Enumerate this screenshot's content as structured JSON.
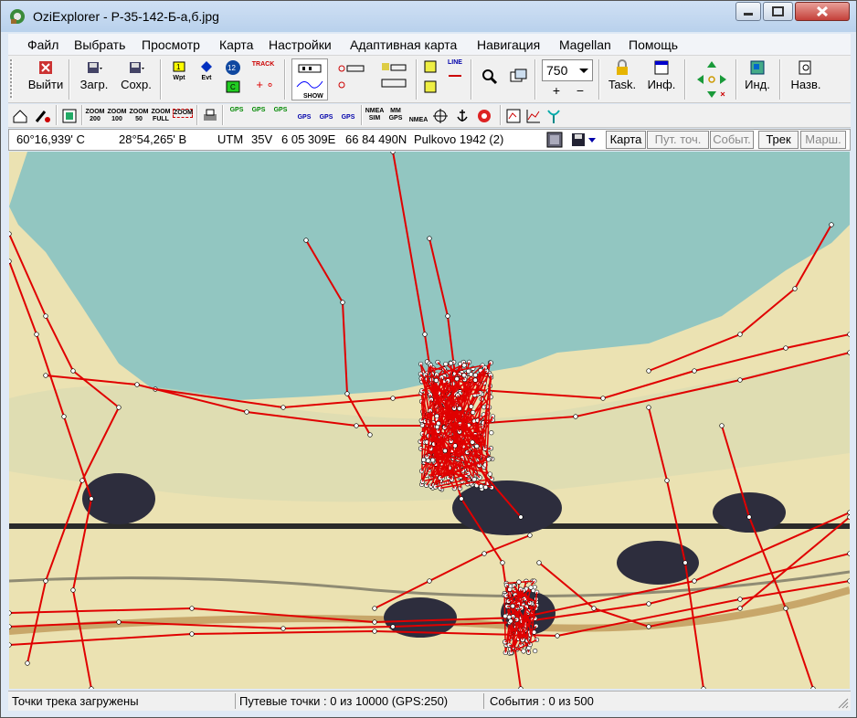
{
  "window": {
    "title": "OziExplorer - P-35-142-Б-а,б.jpg"
  },
  "menu": [
    "Файл",
    "Выбрать",
    "Просмотр",
    "Карта",
    "Настройки",
    "Адаптивная карта",
    "Навигация",
    "Magellan",
    "Помощь"
  ],
  "toolbar": {
    "exit": "Выйти",
    "load": "Загр.",
    "save": "Сохр.",
    "wpt": "Wpt",
    "evt": "Evt",
    "track": "TRACK",
    "show": "SHOW",
    "zoom_value": "750",
    "task": "Task.",
    "info": "Инф.",
    "ind": "Инд.",
    "name": "Назв.",
    "line": "LINE"
  },
  "toolbar2": {
    "zoom": [
      "ZOOM 200",
      "ZOOM 100",
      "ZOOM 50",
      "ZOOM FULL",
      "ZOOM"
    ],
    "gps": [
      "GPS",
      "GPS",
      "GPS",
      "GPS",
      "GPS",
      "GPS"
    ],
    "nmea_sim": "NMEA SIM",
    "mm_gps": "MM GPS",
    "nmea": "NMEA"
  },
  "position": {
    "lat": "60°16,939' С",
    "lon": "28°54,265' В",
    "utm_label": "UTM",
    "utm_zone": "35V",
    "easting": "6 05 309E",
    "northing": "66 84 490N",
    "datum": "Pulkovo 1942 (2)"
  },
  "view_buttons": {
    "map": "Карта",
    "waypoints": "Пут. точ.",
    "events": "Событ.",
    "track": "Трек",
    "route": "Марш."
  },
  "status": {
    "track": "Точки трека загружены",
    "waypoints": "Путевые точки : 0 из 10000  (GPS:250)",
    "events": "События : 0 из 500"
  },
  "colors": {
    "track": "#e00000",
    "water": "#8fc6c0",
    "land": "#ece5b9",
    "shadow": "#3a3a4a"
  }
}
